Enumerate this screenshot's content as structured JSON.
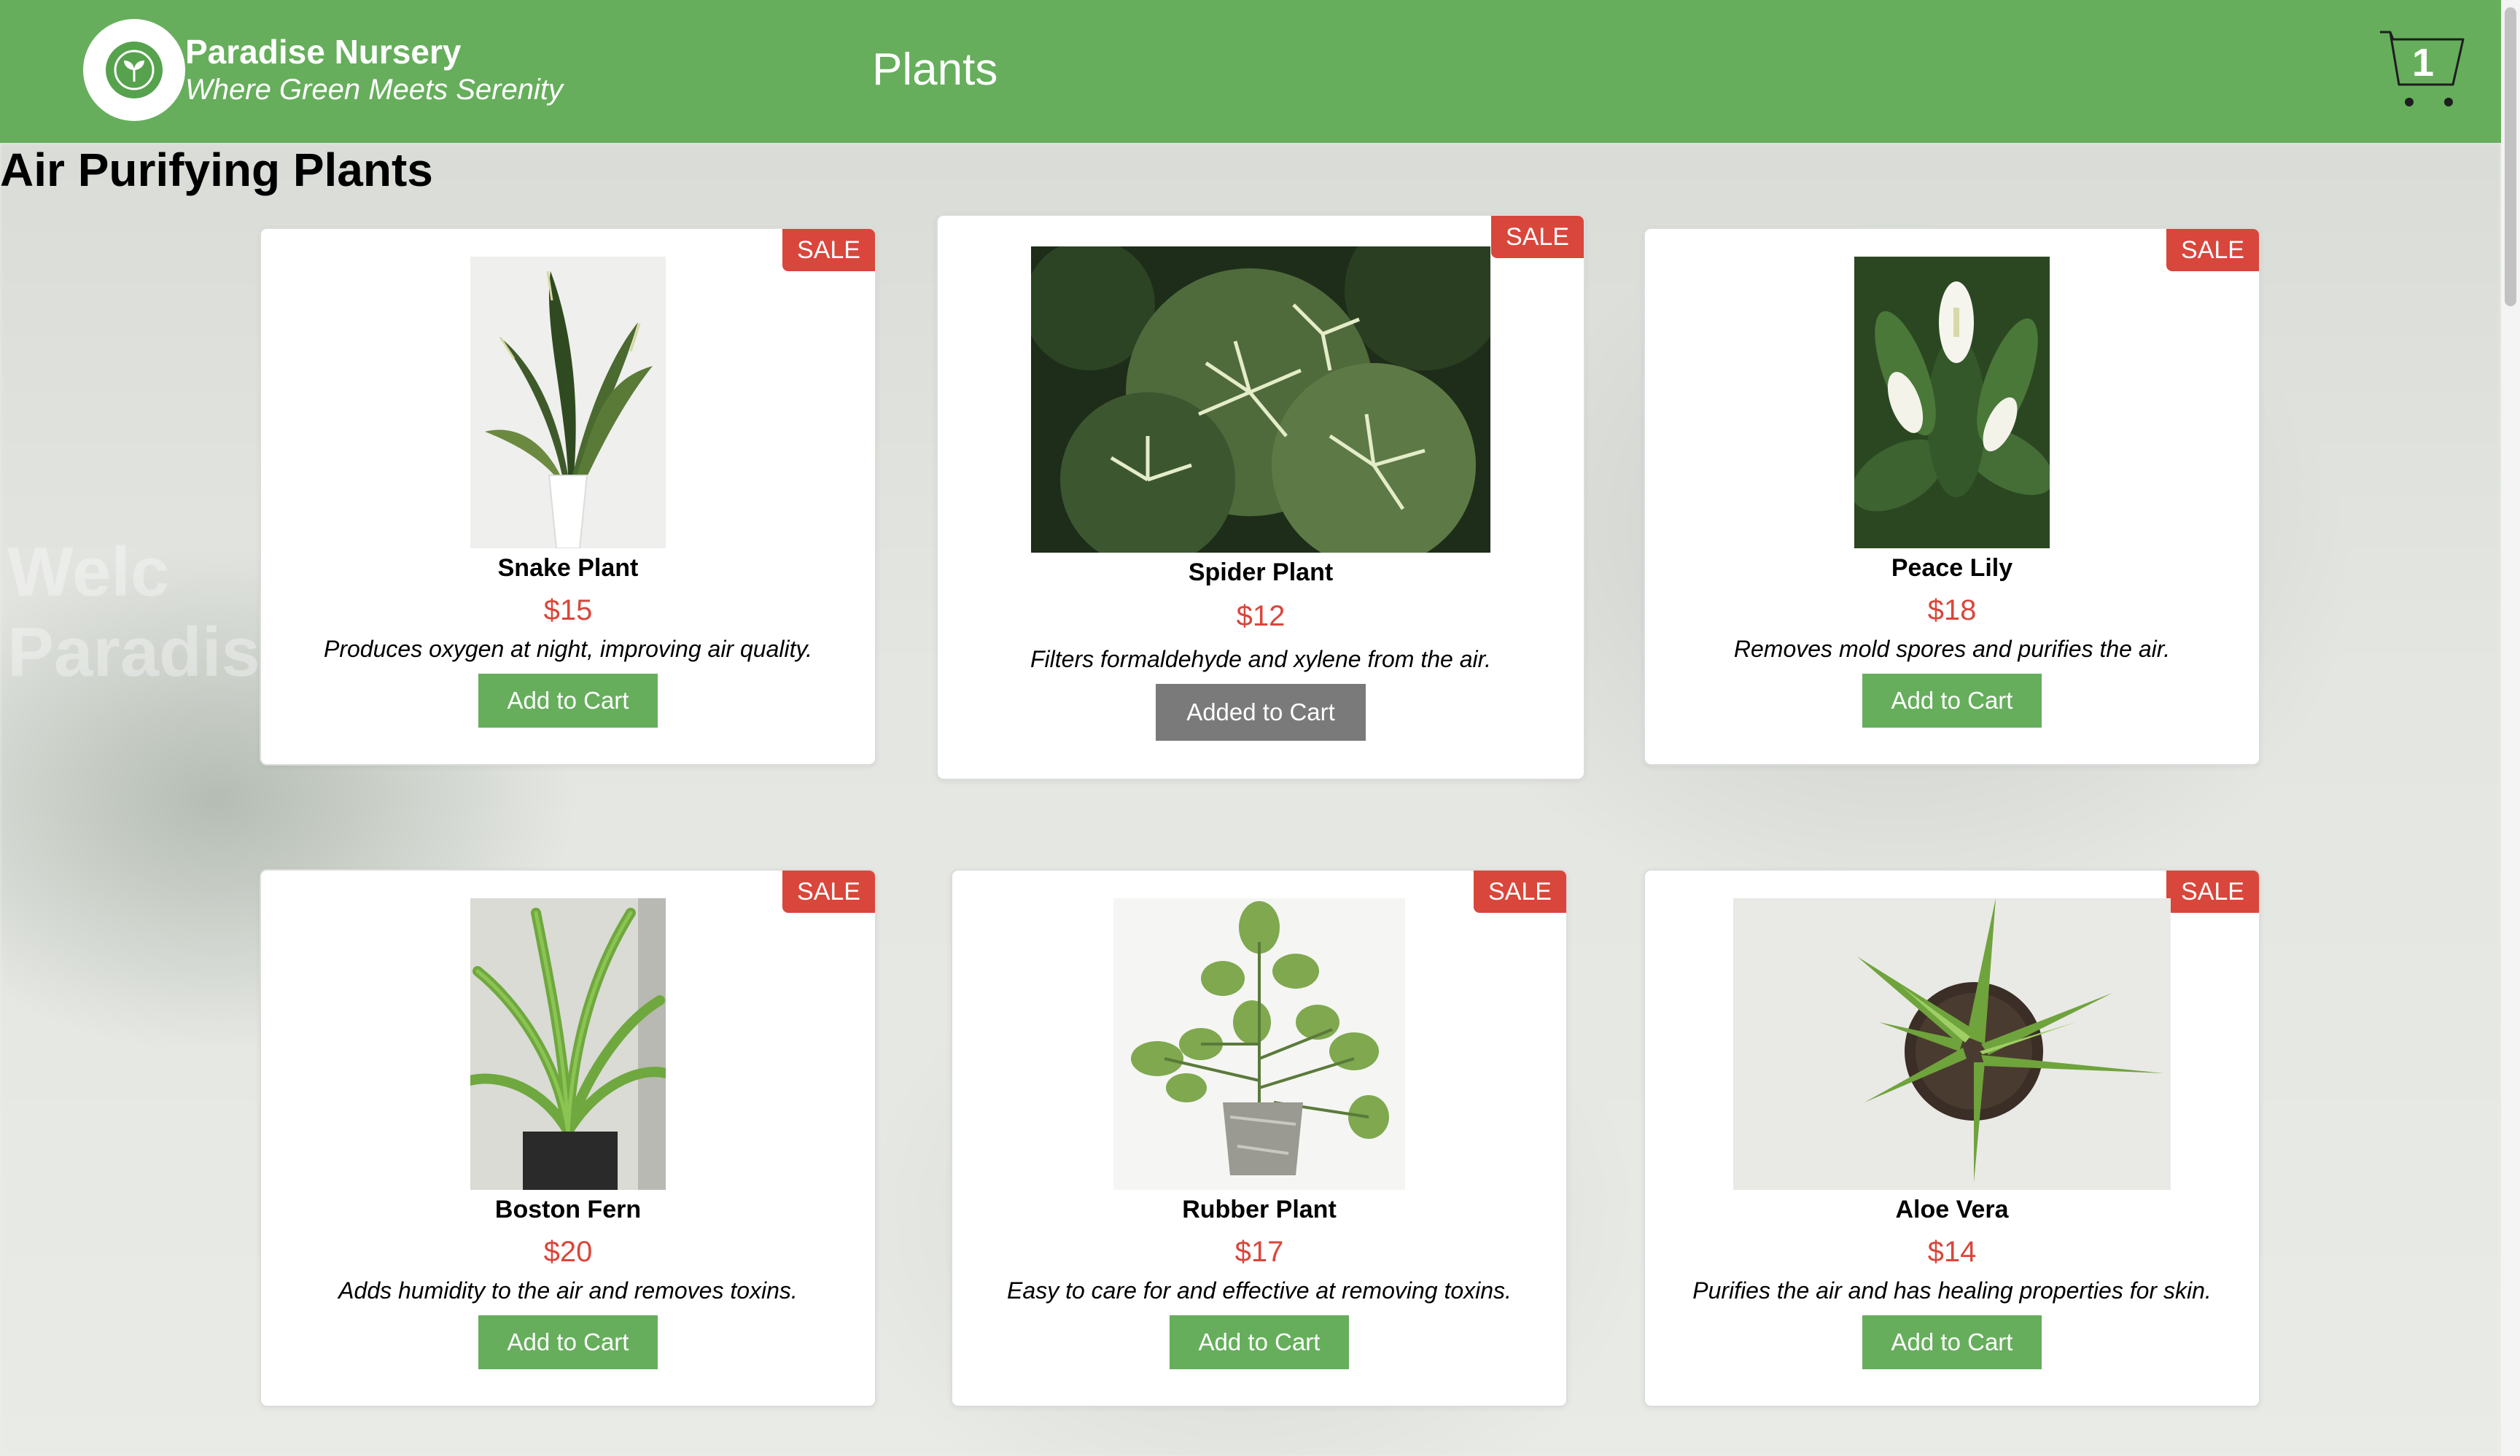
{
  "header": {
    "brand_name": "Paradise Nursery",
    "brand_tagline": "Where Green Meets Serenity",
    "nav_plants": "Plants",
    "cart_count": "1"
  },
  "background": {
    "text_line1": "Welc",
    "text_line2": "Paradis"
  },
  "section": {
    "title": "Air Purifying Plants"
  },
  "colors": {
    "navbar": "#66ae5c",
    "sale_badge": "#d9463b",
    "price": "#d9463b",
    "button": "#66ae5c",
    "button_added": "#7a7a7a"
  },
  "plants": [
    {
      "sale": "SALE",
      "name": "Snake Plant",
      "price": "$15",
      "description": "Produces oxygen at night, improving air quality.",
      "button": "Add to Cart",
      "image_icon": "snake-plant-photo"
    },
    {
      "sale": "SALE",
      "name": "Spider Plant",
      "price": "$12",
      "description": "Filters formaldehyde and xylene from the air.",
      "button": "Added to Cart",
      "image_icon": "spider-plant-photo"
    },
    {
      "sale": "SALE",
      "name": "Peace Lily",
      "price": "$18",
      "description": "Removes mold spores and purifies the air.",
      "button": "Add to Cart",
      "image_icon": "peace-lily-photo"
    },
    {
      "sale": "SALE",
      "name": "Boston Fern",
      "price": "$20",
      "description": "Adds humidity to the air and removes toxins.",
      "button": "Add to Cart",
      "image_icon": "boston-fern-photo"
    },
    {
      "sale": "SALE",
      "name": "Rubber Plant",
      "price": "$17",
      "description": "Easy to care for and effective at removing toxins.",
      "button": "Add to Cart",
      "image_icon": "rubber-plant-photo"
    },
    {
      "sale": "SALE",
      "name": "Aloe Vera",
      "price": "$14",
      "description": "Purifies the air and has healing properties for skin.",
      "button": "Add to Cart",
      "image_icon": "aloe-vera-photo"
    }
  ]
}
